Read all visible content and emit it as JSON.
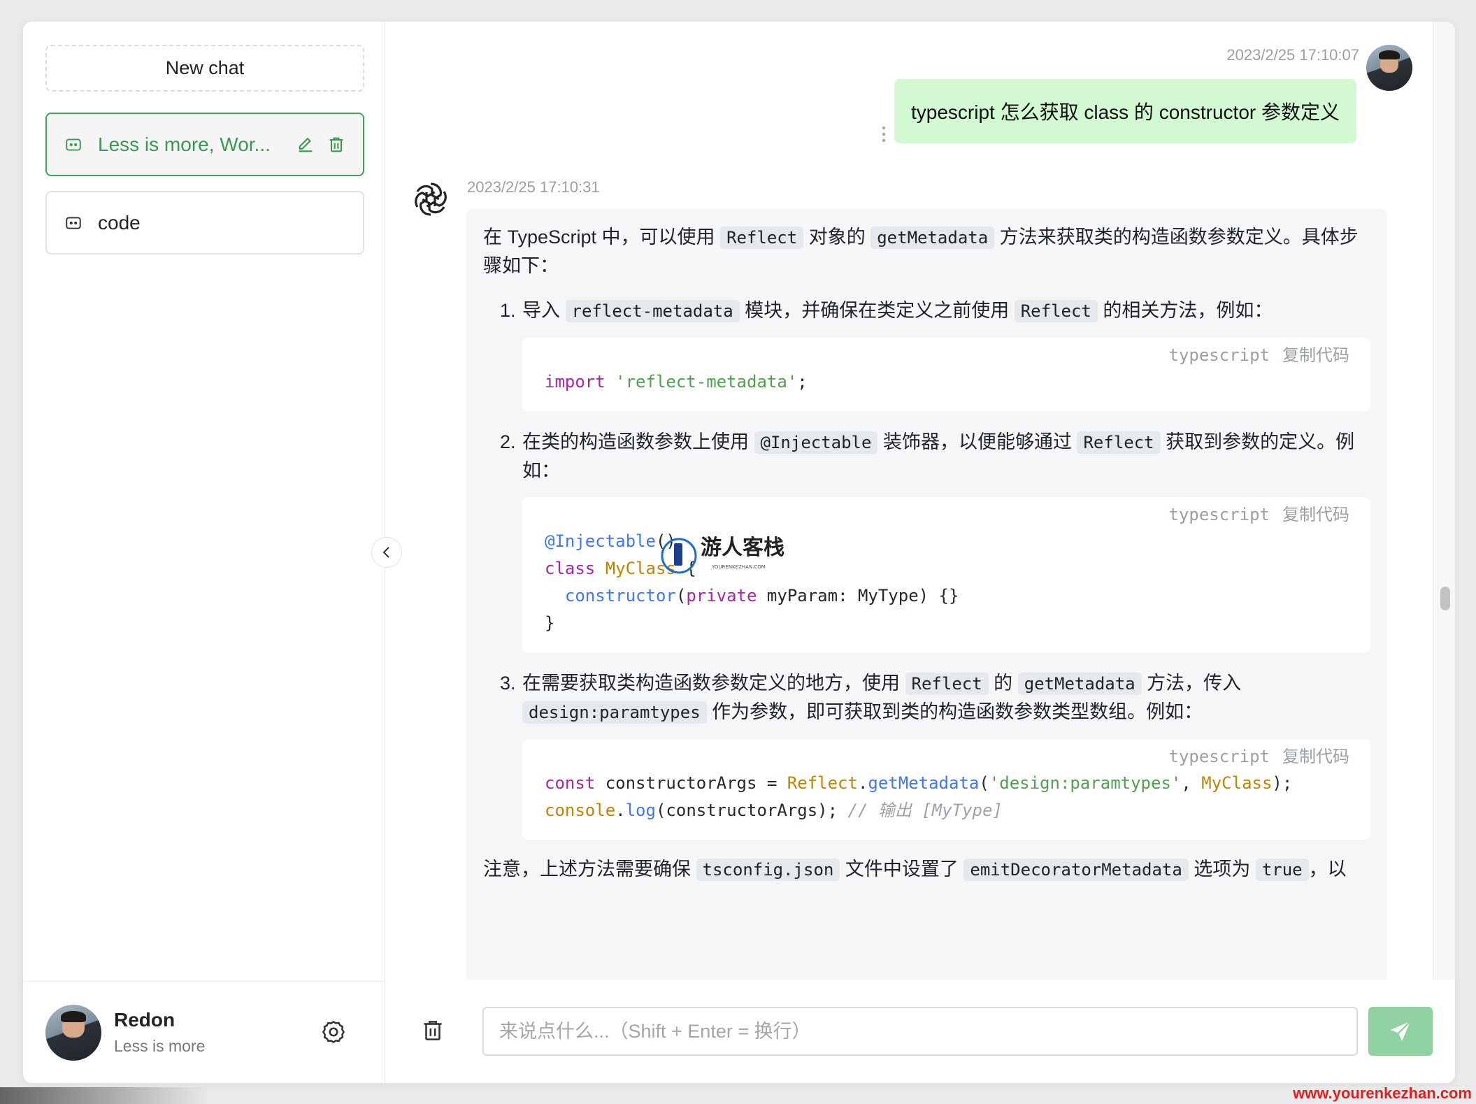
{
  "sidebar": {
    "new_chat": "New chat",
    "history": [
      {
        "label": "Less is more, Wor...",
        "active": true
      },
      {
        "label": "code",
        "active": false
      }
    ],
    "user": {
      "name": "Redon",
      "subtitle": "Less is more"
    }
  },
  "conversation": {
    "user_message": {
      "timestamp": "2023/2/25 17:10:07",
      "text": "typescript 怎么获取 class 的 constructor 参数定义"
    },
    "bot_message": {
      "timestamp": "2023/2/25 17:10:31",
      "intro_1": "在 TypeScript 中，可以使用 ",
      "intro_code_1": "Reflect",
      "intro_2": " 对象的 ",
      "intro_code_2": "getMetadata",
      "intro_3": " 方法来获取类的构造函数参数定义。具体步骤如下：",
      "steps": [
        {
          "num": "1.",
          "t1": "导入 ",
          "c1": "reflect-metadata",
          "t2": " 模块，并确保在类定义之前使用 ",
          "c2": "Reflect",
          "t3": " 的相关方法，例如："
        },
        {
          "num": "2.",
          "t1": "在类的构造函数参数上使用 ",
          "c1": "@Injectable",
          "t2": " 装饰器，以便能够通过 ",
          "c2": "Reflect",
          "t3": " 获取到参数的定义。例如："
        },
        {
          "num": "3.",
          "t1": "在需要获取类构造函数参数定义的地方，使用 ",
          "c1": "Reflect",
          "t2": " 的 ",
          "c2": "getMetadata",
          "t3": " 方法，传入 ",
          "c3": "design:paramtypes",
          "t4": " 作为参数，即可获取到类的构造函数参数类型数组。例如："
        }
      ],
      "code_lang": "typescript",
      "copy_label": "复制代码",
      "code_1": {
        "kw": "import",
        "str": "'reflect-metadata'",
        "end": ";"
      },
      "code_2": {
        "l1_dec": "@Injectable",
        "l1_end": "()",
        "l2_kw": "class",
        "l2_cls": "MyClass",
        "l2_end": " {",
        "l3_fn": "constructor",
        "l3_a": "(",
        "l3_kw": "private",
        "l3_b": " myParam: MyType) {}",
        "l4": "}"
      },
      "code_3": {
        "l1_kw": "const",
        "l1_a": " constructorArgs = ",
        "l1_cls": "Reflect",
        "l1_dot": ".",
        "l1_fn": "getMetadata",
        "l1_b": "(",
        "l1_str": "'design:paramtypes'",
        "l1_c": ", ",
        "l1_cls2": "MyClass",
        "l1_end": ");",
        "l2_cls": "console",
        "l2_dot": ".",
        "l2_fn": "log",
        "l2_a": "(constructorArgs); ",
        "l2_cm": "// 输出 [MyType]"
      },
      "note_1": "注意，上述方法需要确保 ",
      "note_code_1": "tsconfig.json",
      "note_2": " 文件中设置了 ",
      "note_code_2": "emitDecoratorMetadata",
      "note_3": " 选项为 ",
      "note_code_3": "true",
      "note_4": "，以"
    }
  },
  "input": {
    "placeholder": "来说点什么...（Shift + Enter = 换行）",
    "value": ""
  },
  "watermark": {
    "name": "游人客栈",
    "sub": "YOURENKEZHAN.COM"
  },
  "site_mark": "www.yourenkezhan.com",
  "colors": {
    "accent": "#3fa45a",
    "user_bubble": "#d2f9d1",
    "send_button": "#8fd1a1"
  }
}
